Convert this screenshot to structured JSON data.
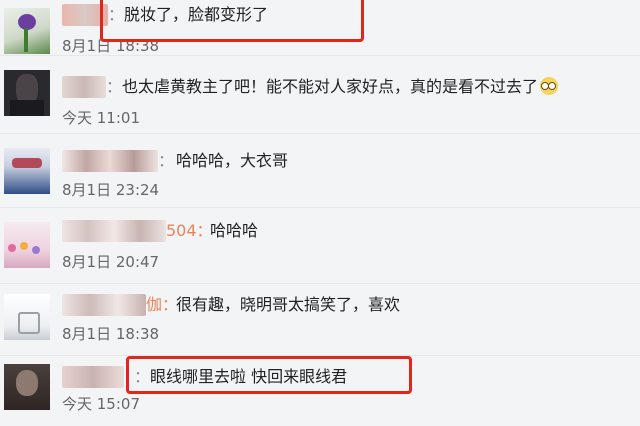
{
  "comments": [
    {
      "nick_suffix": "：",
      "text": "脱妆了，脸都变形了",
      "time": "8月1日 18:38"
    },
    {
      "nick_suffix": "：",
      "text": "也太虐黄教主了吧！能不能对人家好点，真的是看不过去了",
      "time": "今天 11:01",
      "emoji": "glasses-face-emoji"
    },
    {
      "nick_suffix": "：",
      "text": "哈哈哈，大衣哥",
      "time": "8月1日 23:24"
    },
    {
      "nick_suffix": "504：",
      "text": "哈哈哈",
      "time": "8月1日 20:47"
    },
    {
      "nick_suffix": "伽：",
      "text": "很有趣，晓明哥太搞笑了，喜欢",
      "time": "8月1日 18:38"
    },
    {
      "nick_suffix": "：",
      "text": "眼线哪里去啦 快回来眼线君",
      "time": "今天 15:07"
    }
  ],
  "colors": {
    "highlight": "#e3261c",
    "background": "#f3f4f6"
  }
}
